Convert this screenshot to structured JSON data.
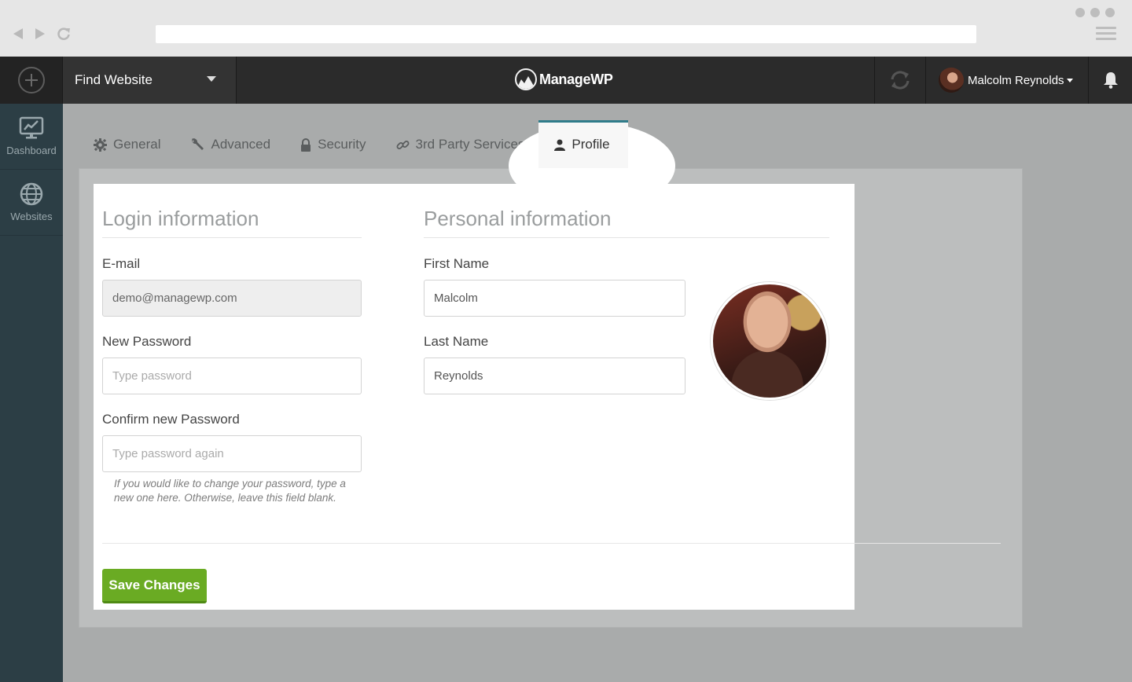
{
  "app": {
    "logo_text": "ManageWP",
    "find_website": "Find Website",
    "user_name": "Malcolm Reynolds"
  },
  "sidebar": {
    "items": [
      {
        "label": "Dashboard",
        "icon": "dashboard-icon"
      },
      {
        "label": "Websites",
        "icon": "globe-icon"
      }
    ]
  },
  "tabs": [
    {
      "label": "General",
      "icon": "gear-icon"
    },
    {
      "label": "Advanced",
      "icon": "wrench-icon"
    },
    {
      "label": "Security",
      "icon": "lock-icon"
    },
    {
      "label": "3rd Party Services",
      "icon": "link-icon"
    },
    {
      "label": "Profile",
      "icon": "user-icon",
      "active": true
    }
  ],
  "login": {
    "title": "Login information",
    "email_label": "E-mail",
    "email_value": "demo@managewp.com",
    "new_password_label": "New Password",
    "new_password_placeholder": "Type password",
    "confirm_password_label": "Confirm new Password",
    "confirm_password_placeholder": "Type password again",
    "hint": "If you would like to change your password, type a new one here. Otherwise, leave this field blank."
  },
  "personal": {
    "title": "Personal information",
    "first_name_label": "First Name",
    "first_name_value": "Malcolm",
    "last_name_label": "Last Name",
    "last_name_value": "Reynolds"
  },
  "actions": {
    "save_label": "Save Changes"
  },
  "colors": {
    "accent": "#2f7c8a",
    "save_button": "#6aab23",
    "topbar": "#2b2b2b",
    "sidebar": "#2c3e45"
  }
}
